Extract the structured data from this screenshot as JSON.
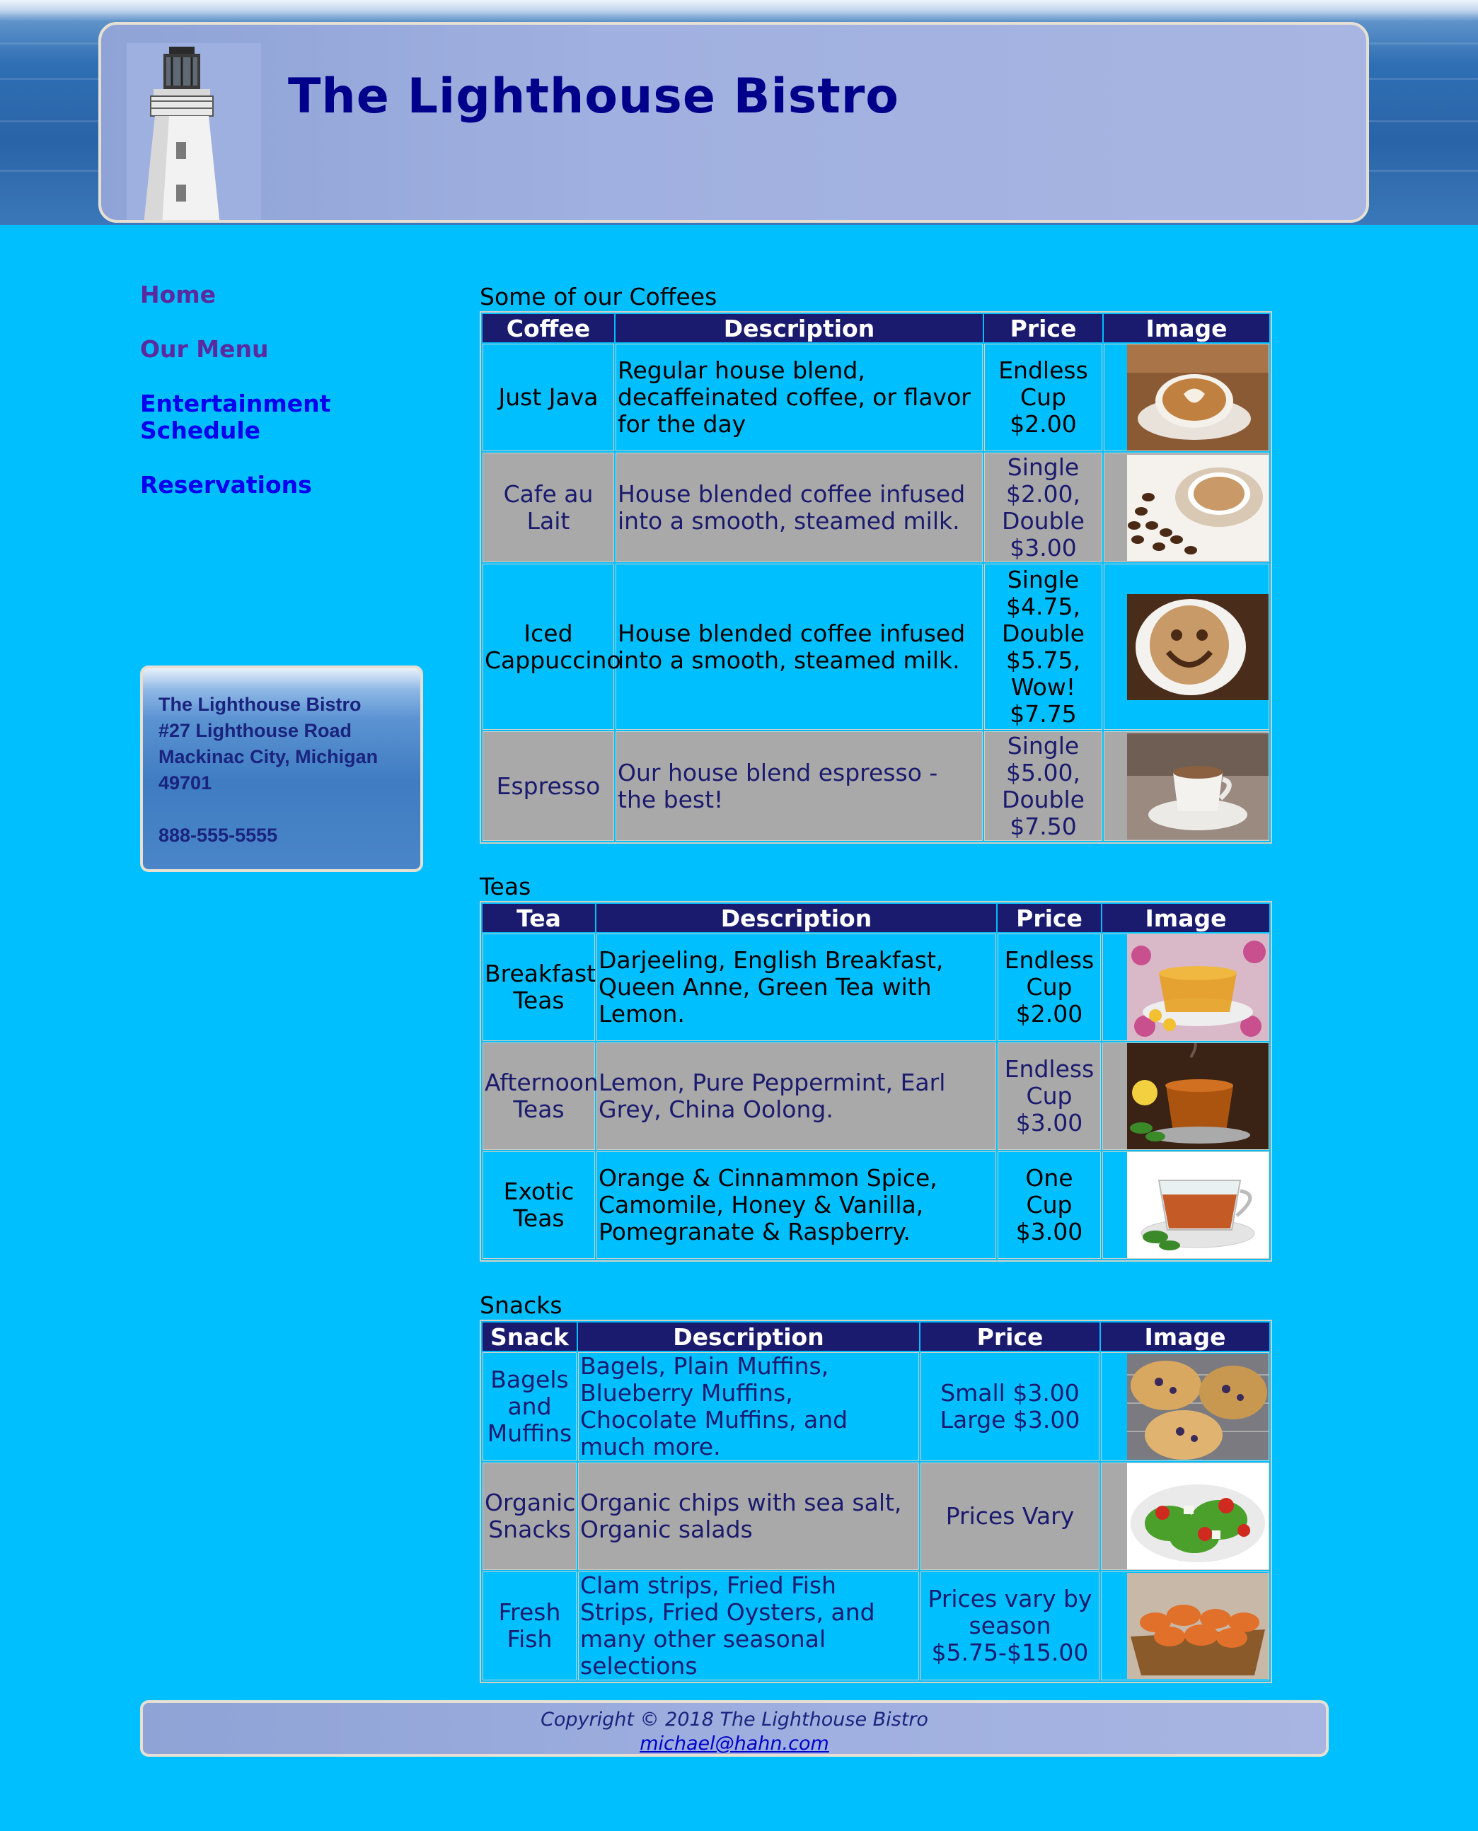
{
  "header": {
    "title": "The Lighthouse Bistro"
  },
  "nav": {
    "items": [
      {
        "label": "Home"
      },
      {
        "label": "Our Menu"
      },
      {
        "label": "Entertainment Schedule"
      },
      {
        "label": "Reservations"
      }
    ]
  },
  "address": {
    "name": "The Lighthouse Bistro",
    "street": "#27 Lighthouse Road",
    "city": "Mackinac City, Michigan",
    "zip": "49701",
    "phone": "888-555-5555"
  },
  "coffees": {
    "caption": "Some of our Coffees",
    "headers": [
      "Coffee",
      "Description",
      "Price",
      "Image"
    ],
    "rows": [
      {
        "name": "Just Java",
        "desc": "Regular house blend, decaffeinated coffee, or flavor for the day",
        "price": "Endless Cup $2.00",
        "image": "latte-art-image"
      },
      {
        "name": "Cafe au Lait",
        "desc": "House blended coffee infused into a smooth, steamed milk.",
        "price": "Single $2.00, Double $3.00",
        "image": "coffee-beans-cup-image"
      },
      {
        "name": "Iced Cappuccino",
        "desc": "House blended coffee infused into a smooth, steamed milk.",
        "price": "Single $4.75, Double $5.75, Wow! $7.75",
        "image": "smiley-cappuccino-image"
      },
      {
        "name": "Espresso",
        "desc": "Our house blend espresso - the best!",
        "price": "Single $5.00, Double $7.50",
        "image": "espresso-cup-image"
      }
    ]
  },
  "teas": {
    "caption": "Teas",
    "headers": [
      "Tea",
      "Description",
      "Price",
      "Image"
    ],
    "rows": [
      {
        "name": "Breakfast Teas",
        "desc": "Darjeeling, English Breakfast, Queen Anne, Green Tea with Lemon.",
        "price": "Endless Cup $2.00",
        "image": "tea-flowers-image"
      },
      {
        "name": "Afternoon Teas",
        "desc": "Lemon, Pure Peppermint, Earl Grey, China Oolong.",
        "price": "Endless Cup $3.00",
        "image": "tea-lemon-image"
      },
      {
        "name": "Exotic Teas",
        "desc": "Orange & Cinnammon Spice, Camomile, Honey & Vanilla, Pomegranate & Raspberry.",
        "price": "One Cup $3.00",
        "image": "glass-tea-cup-image"
      }
    ]
  },
  "snacks": {
    "caption": "Snacks",
    "headers": [
      "Snack",
      "Description",
      "Price",
      "Image"
    ],
    "rows": [
      {
        "name": "Bagels and Muffins",
        "desc": "Bagels, Plain Muffins, Blueberry Muffins, Chocolate Muffins, and much more.",
        "price": "Small $3.00 Large $3.00",
        "image": "muffins-image"
      },
      {
        "name": "Organic Snacks",
        "desc": "Organic chips with sea salt, Organic salads",
        "price": "Prices Vary",
        "image": "salad-image"
      },
      {
        "name": "Fresh Fish",
        "desc": "Clam strips, Fried Fish Strips, Fried Oysters, and many other seasonal selections",
        "price": "Prices vary by season $5.75-$15.00",
        "image": "fried-fish-image"
      }
    ]
  },
  "footer": {
    "copyright": "Copyright © 2018 The Lighthouse Bistro",
    "email": "michael@hahn.com"
  },
  "colors": {
    "background": "#00bfff",
    "header_text": "#00008b",
    "table_header": "#1a1a6e",
    "alt_row": "#a9a9a9"
  }
}
